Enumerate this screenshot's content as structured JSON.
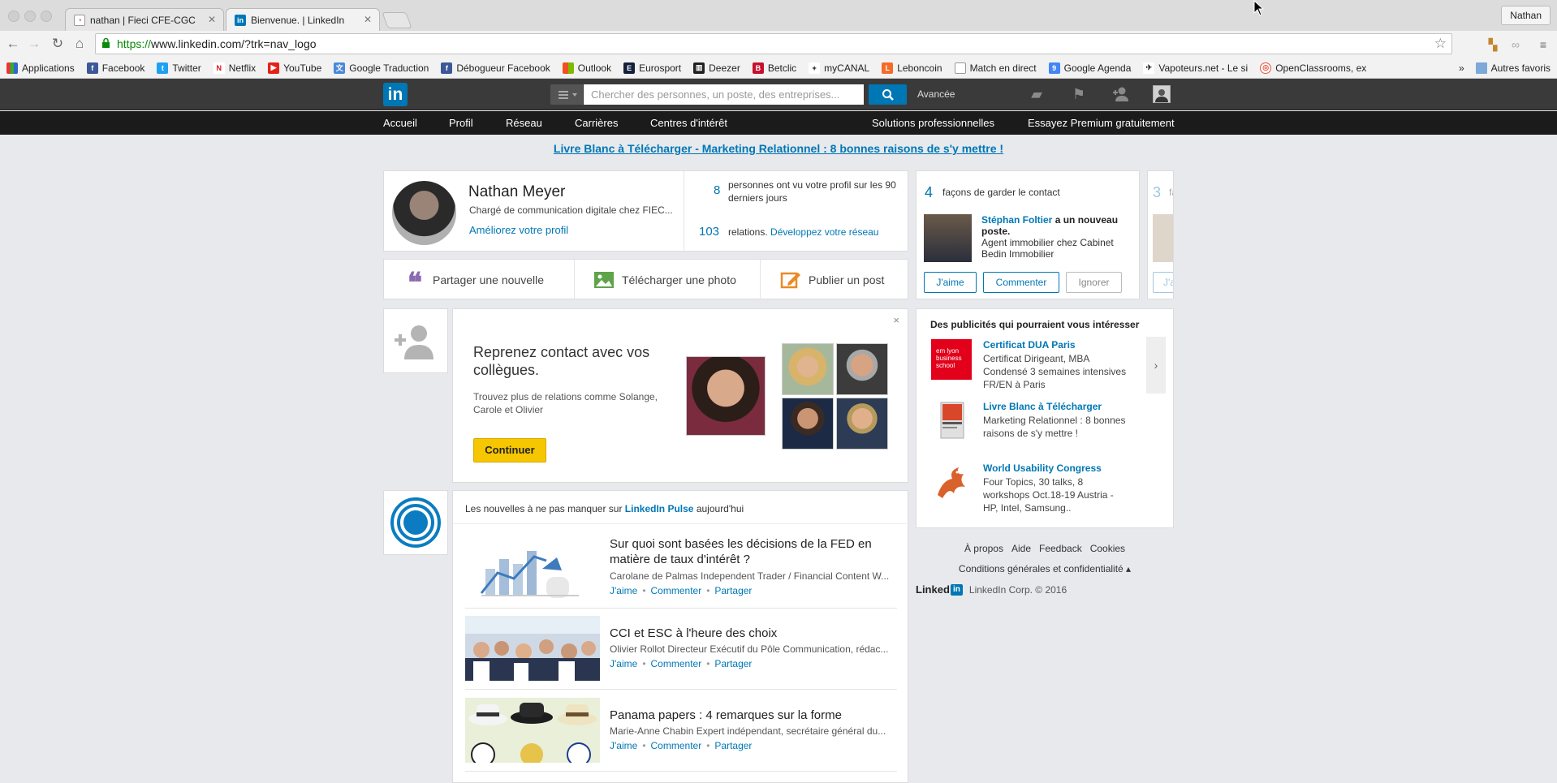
{
  "browser": {
    "tabs": [
      {
        "title": "nathan | Fieci CFE-CGC",
        "active": false
      },
      {
        "title": "Bienvenue. | LinkedIn",
        "active": true
      }
    ],
    "profile_name": "Nathan",
    "url_https": "https://",
    "url_rest": "www.linkedin.com/?trk=nav_logo",
    "bookmarks": [
      "Applications",
      "Facebook",
      "Twitter",
      "Netflix",
      "YouTube",
      "Google Traduction",
      "Débogueur Facebook",
      "Outlook",
      "Eurosport",
      "Deezer",
      "Betclic",
      "myCANAL",
      "Leboncoin",
      "Match en direct",
      "Google Agenda",
      "Vapoteurs.net - Le si",
      "OpenClassrooms, ex"
    ],
    "bookmarks_more": "»",
    "other_bookmarks": "Autres favoris"
  },
  "linkedin": {
    "logo": "in",
    "search_placeholder": "Chercher des personnes, un poste, des entreprises...",
    "advanced": "Avancée",
    "nav": [
      "Accueil",
      "Profil",
      "Réseau",
      "Carrières",
      "Centres d'intérêt"
    ],
    "nav_right": [
      "Solutions professionnelles",
      "Essayez Premium gratuitement"
    ],
    "banner": "Livre Blanc à Télécharger - Marketing Relationnel : 8 bonnes raisons de s'y mettre !",
    "profile": {
      "name": "Nathan Meyer",
      "title": "Chargé de communication digitale chez FIEC...",
      "improve": "Améliorez votre profil",
      "views_count": "8",
      "views_text": "personnes ont vu votre profil sur les 90 derniers jours",
      "connections_count": "103",
      "connections_text": "relations.",
      "connections_link": "Développez votre réseau"
    },
    "share": [
      "Partager une nouvelle",
      "Télécharger une photo",
      "Publier un post"
    ],
    "pymk": {
      "heading": "Reprenez contact avec vos collègues.",
      "sub": "Trouvez plus de relations comme Solange, Carole et Olivier",
      "button": "Continuer",
      "close": "×"
    },
    "pulse": {
      "prefix": "Les nouvelles à ne pas manquer sur",
      "link": "LinkedIn Pulse",
      "suffix": "aujourd'hui",
      "articles": [
        {
          "title": "Sur quoi sont basées les décisions de la FED en matière de taux d'intérêt ?",
          "meta": "Carolane de Palmas Independent Trader / Financial Content W...",
          "like": "J'aime",
          "comment": "Commenter",
          "share": "Partager"
        },
        {
          "title": "CCI et ESC à l'heure des choix",
          "meta": "Olivier Rollot Directeur Exécutif du Pôle Communication, rédac...",
          "like": "J'aime",
          "comment": "Commenter",
          "share": "Partager"
        },
        {
          "title": "Panama papers : 4 remarques sur la forme",
          "meta": "Marie-Anne Chabin Expert indépendant, secrétaire général du...",
          "like": "J'aime",
          "comment": "Commenter",
          "share": "Partager"
        }
      ]
    },
    "keep_in_touch": {
      "count": "4",
      "label": "façons de garder le contact",
      "person": "Stéphan Foltier",
      "action": "a un nouveau poste.",
      "detail": "Agent immobilier chez Cabinet Bedin Immobilier",
      "like": "J'aime",
      "comment": "Commenter",
      "ignore": "Ignorer",
      "peek_count": "3",
      "peek_letter": "fa",
      "peek_button": "J'a"
    },
    "ads": {
      "title": "Des publicités qui pourraient vous intéresser",
      "items": [
        {
          "title": "Certificat DUA Paris",
          "desc": "Certificat Dirigeant, MBA Condensé 3 semaines intensives FR/EN à Paris",
          "brand": "em lyon business school"
        },
        {
          "title": "Livre Blanc à Télécharger",
          "desc": "Marketing Relationnel : 8 bonnes raisons de s'y mettre !",
          "brand": ""
        },
        {
          "title": "World Usability Congress",
          "desc": "Four Topics, 30 talks, 8 workshops Oct.18-19 Austria - HP, Intel, Samsung..",
          "brand": ""
        }
      ],
      "next": "›"
    },
    "footer": {
      "links": [
        "À propos",
        "Aide",
        "Feedback",
        "Cookies"
      ],
      "terms": "Conditions générales et confidentialité ▴",
      "brand_word": "Linked",
      "brand_in": "in",
      "copyright": "LinkedIn Corp. © 2016"
    }
  }
}
